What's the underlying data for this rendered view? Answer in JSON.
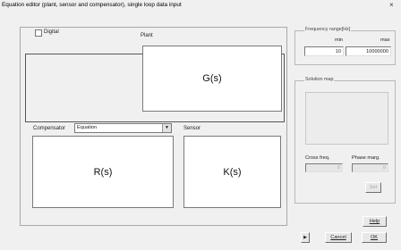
{
  "window": {
    "title": "Equation editor (plant, sensor and compensator), single loop data input",
    "close_glyph": "×"
  },
  "digital": {
    "label": "Digital",
    "checked": false
  },
  "plant": {
    "label": "Plant",
    "expression": "G(s)"
  },
  "compensator": {
    "label": "Compensator",
    "selected": "Equation",
    "expression": "R(s)"
  },
  "sensor": {
    "label": "Sensor",
    "expression": "K(s)"
  },
  "frequency_range": {
    "legend": "Frequency range[Hz]",
    "min_label": "min",
    "max_label": "max",
    "min_value": "10",
    "max_value": "10000000"
  },
  "solution_map": {
    "legend": "Solution map"
  },
  "cross_freq": {
    "label": "Cross freq.",
    "value": "0"
  },
  "phase_marg": {
    "label": "Phase marg.",
    "value": "0"
  },
  "buttons": {
    "set": "Set",
    "help": "Help",
    "cancel": "Cancel",
    "ok": "OK",
    "arrow": "▶"
  }
}
